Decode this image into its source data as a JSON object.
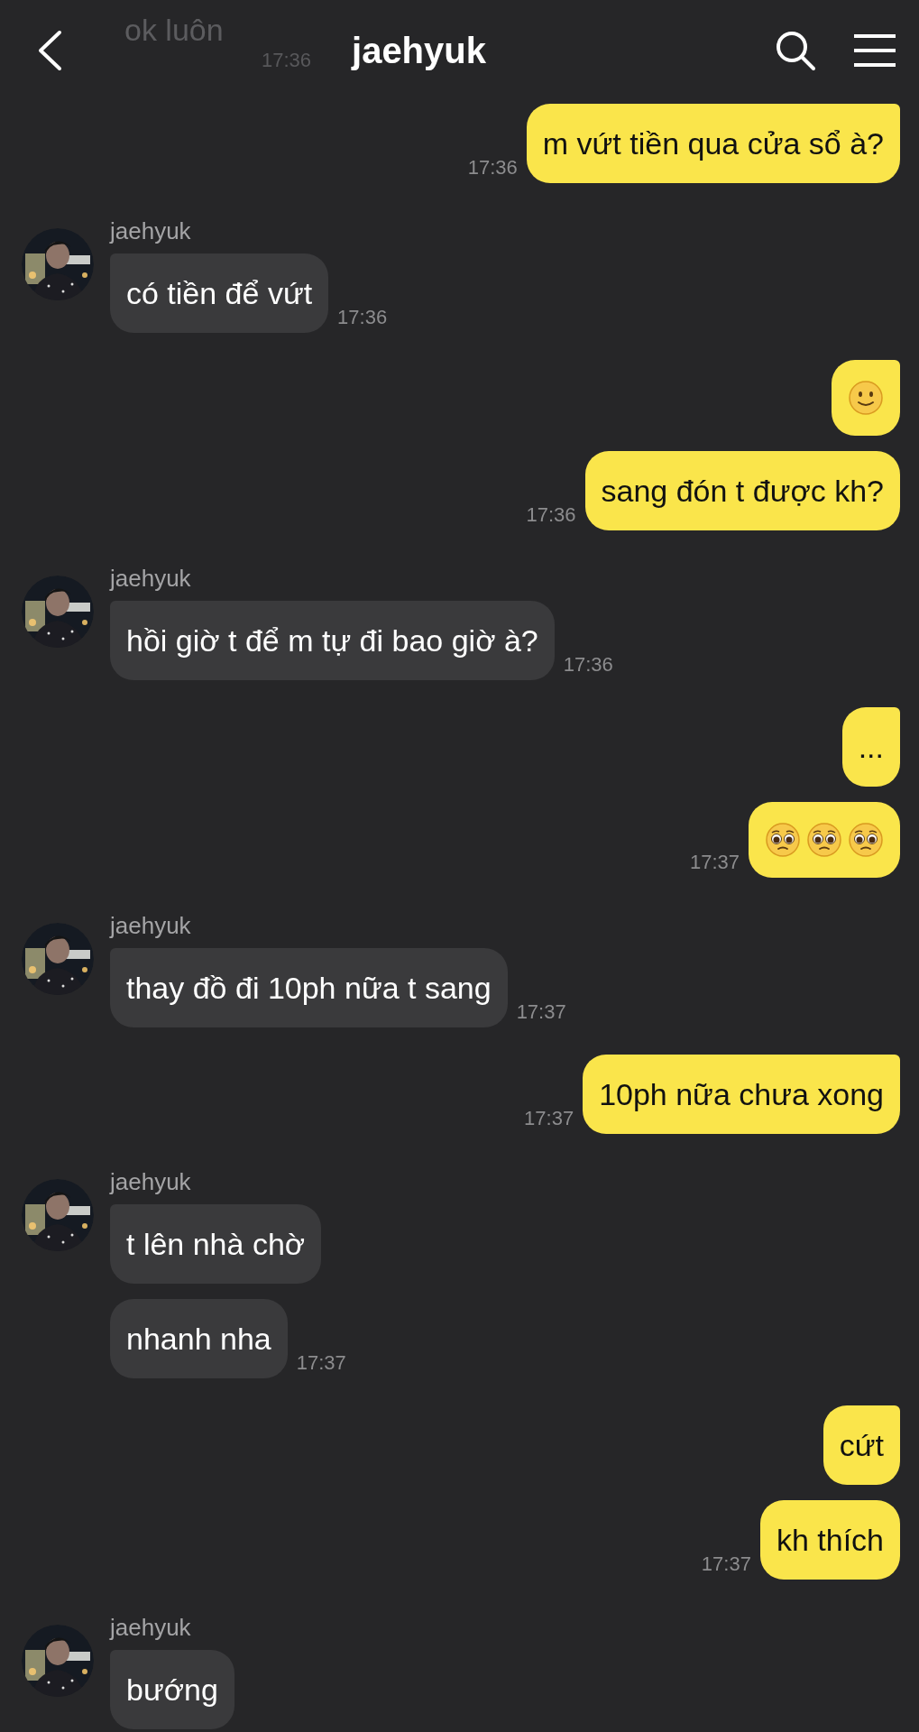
{
  "header": {
    "title": "jaehyuk",
    "behind": {
      "text": "ok luôn",
      "time": "17:36"
    }
  },
  "groups": [
    {
      "kind": "outgoing",
      "messages": [
        {
          "kind": "text",
          "text": "m vứt tiền qua cửa sổ à?"
        }
      ],
      "time": "17:36"
    },
    {
      "kind": "incoming",
      "name": "jaehyuk",
      "messages": [
        {
          "kind": "text",
          "text": "có tiền để vứt"
        }
      ],
      "time": "17:36"
    },
    {
      "kind": "outgoing",
      "messages": [
        {
          "kind": "emoji",
          "emoji": [
            {
              "kind": "smile"
            }
          ]
        },
        {
          "kind": "text",
          "text": "sang đón t được kh?"
        }
      ],
      "time": "17:36"
    },
    {
      "kind": "incoming",
      "name": "jaehyuk",
      "messages": [
        {
          "kind": "text",
          "text": "hồi giờ t để m tự đi bao giờ à?"
        }
      ],
      "time": "17:36"
    },
    {
      "kind": "outgoing",
      "messages": [
        {
          "kind": "text",
          "text": "..."
        },
        {
          "kind": "emoji",
          "emoji": [
            {
              "kind": "pleading"
            },
            {
              "kind": "pleading"
            },
            {
              "kind": "pleading"
            }
          ]
        }
      ],
      "time": "17:37"
    },
    {
      "kind": "incoming",
      "name": "jaehyuk",
      "messages": [
        {
          "kind": "text",
          "text": "thay đồ đi 10ph nữa t sang"
        }
      ],
      "time": "17:37"
    },
    {
      "kind": "outgoing",
      "messages": [
        {
          "kind": "text",
          "text": "10ph nữa chưa xong"
        }
      ],
      "time": "17:37"
    },
    {
      "kind": "incoming",
      "name": "jaehyuk",
      "messages": [
        {
          "kind": "text",
          "text": "t lên nhà chờ"
        },
        {
          "kind": "text",
          "text": "nhanh nha"
        }
      ],
      "time": "17:37"
    },
    {
      "kind": "outgoing",
      "messages": [
        {
          "kind": "text",
          "text": "cứt"
        },
        {
          "kind": "text",
          "text": "kh thích"
        }
      ],
      "time": "17:37"
    },
    {
      "kind": "incoming",
      "name": "jaehyuk",
      "messages": [
        {
          "kind": "text",
          "text": "bướng"
        }
      ]
    }
  ]
}
